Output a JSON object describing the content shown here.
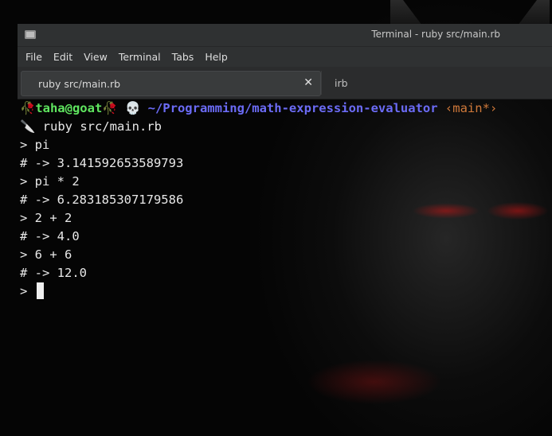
{
  "window": {
    "title": "Terminal - ruby src/main.rb"
  },
  "menu": [
    "File",
    "Edit",
    "View",
    "Terminal",
    "Tabs",
    "Help"
  ],
  "tabs": [
    {
      "label": "ruby src/main.rb",
      "active": true
    },
    {
      "label": "irb",
      "active": false
    }
  ],
  "prompt": {
    "rose_glyph": "🥀",
    "user_host": "taha@goat",
    "skull_glyph": "💀",
    "path": "~/Programming/math-expression-evaluator",
    "branch": "‹main*›",
    "knife_glyph": "🔪",
    "command": "ruby src/main.rb"
  },
  "session": [
    "> pi",
    "# -> 3.141592653589793",
    "> pi * 2",
    "# -> 6.283185307179586",
    "> 2 + 2",
    "# -> 4.0",
    "> 6 + 6",
    "# -> 12.0"
  ],
  "input_prompt": ">",
  "colors": {
    "user": "#5fe55f",
    "path": "#6b6bf5",
    "branch": "#d0793a",
    "titlebar": "#2f3132"
  }
}
